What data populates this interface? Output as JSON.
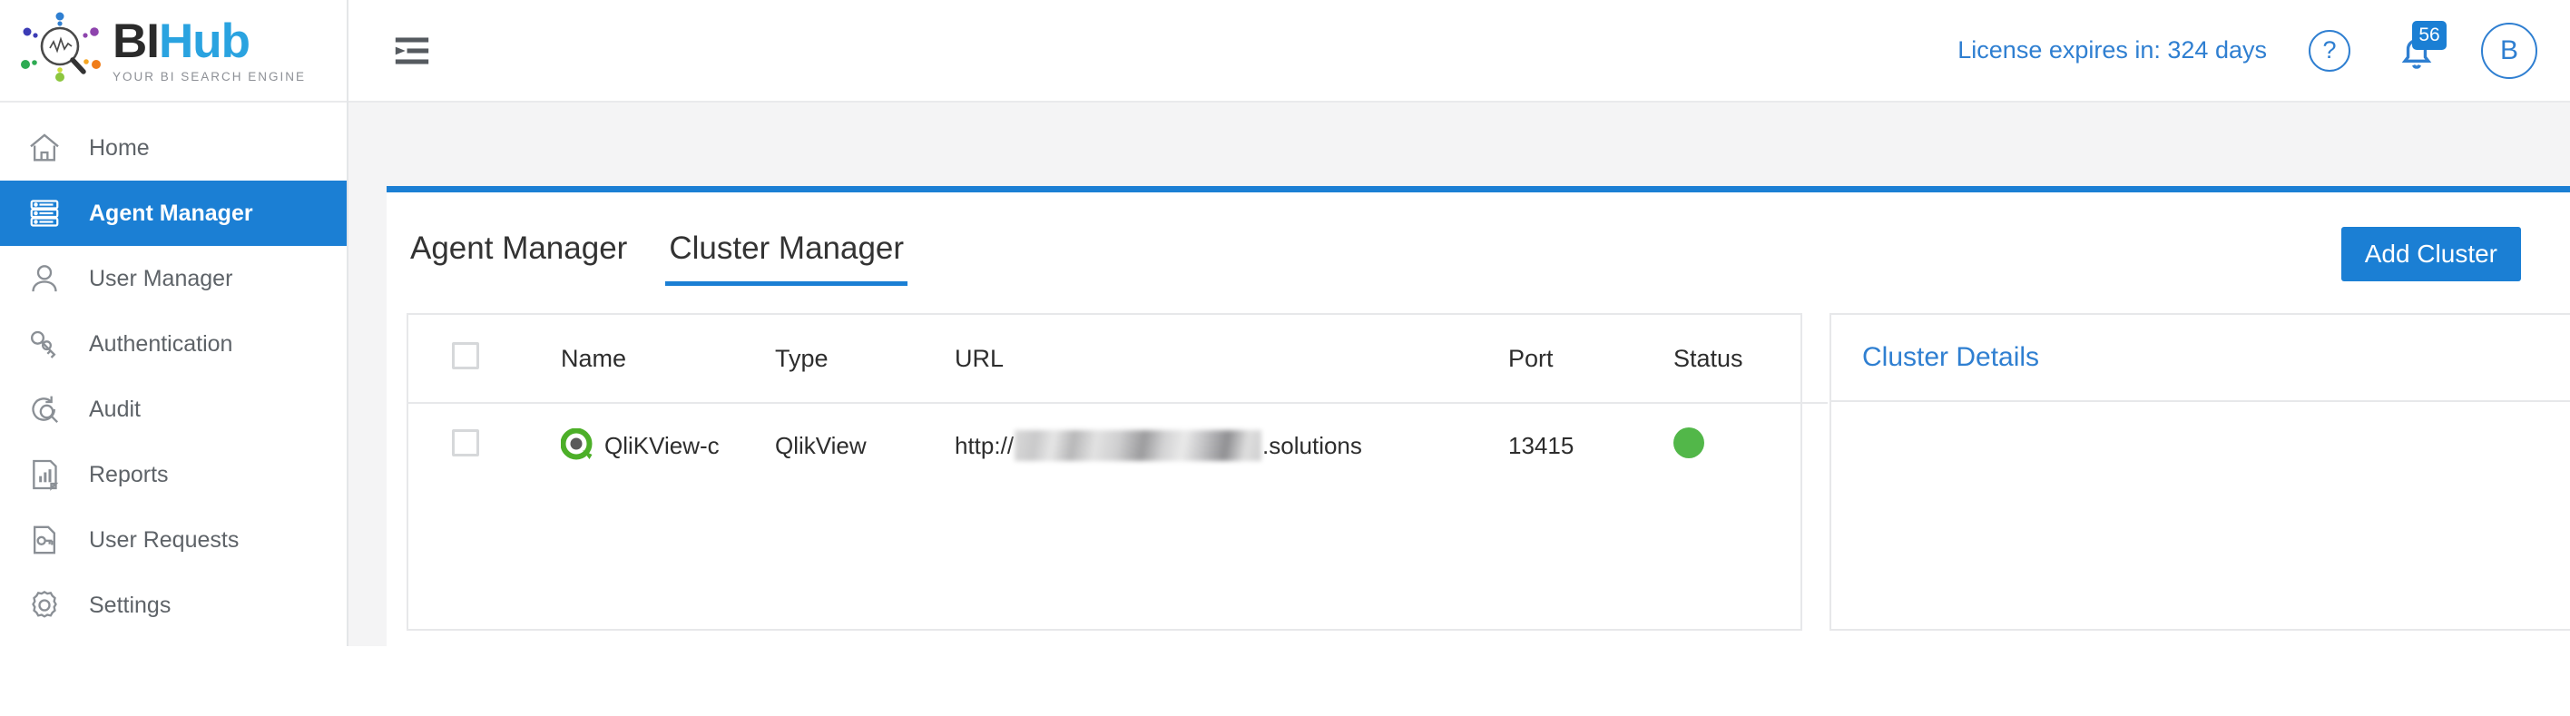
{
  "brand": {
    "name_part1": "BI",
    "name_part2": "Hub",
    "tagline": "YOUR BI SEARCH ENGINE"
  },
  "sidebar": {
    "items": [
      {
        "label": "Home",
        "icon": "home-icon",
        "active": false
      },
      {
        "label": "Agent Manager",
        "icon": "server-icon",
        "active": true
      },
      {
        "label": "User Manager",
        "icon": "user-icon",
        "active": false
      },
      {
        "label": "Authentication",
        "icon": "key-icon",
        "active": false
      },
      {
        "label": "Audit",
        "icon": "audit-search-icon",
        "active": false
      },
      {
        "label": "Reports",
        "icon": "report-chart-icon",
        "active": false
      },
      {
        "label": "User Requests",
        "icon": "document-key-icon",
        "active": false
      },
      {
        "label": "Settings",
        "icon": "gear-icon",
        "active": false
      }
    ]
  },
  "topbar": {
    "menu_icon": "collapse-menu-icon",
    "license": "License expires in: 324 days",
    "help_label": "?",
    "notifications_count": "56",
    "avatar_initial": "B"
  },
  "main": {
    "tabs": [
      {
        "label": "Agent Manager",
        "active": false
      },
      {
        "label": "Cluster Manager",
        "active": true
      }
    ],
    "add_cluster_label": "Add Cluster",
    "table": {
      "columns": [
        "",
        "Name",
        "Type",
        "URL",
        "Port",
        "Status"
      ],
      "rows": [
        {
          "name": "QliKView-c",
          "type": "QlikView",
          "url_prefix": "http://",
          "url_redacted": true,
          "url_suffix": ".solutions",
          "port": "13415",
          "status": "online"
        }
      ]
    },
    "details": {
      "title": "Cluster Details"
    }
  },
  "colors": {
    "accent": "#1b7fd4",
    "link": "#2f7fd1",
    "status_online": "#52b749",
    "page_bg": "#f4f4f5"
  }
}
